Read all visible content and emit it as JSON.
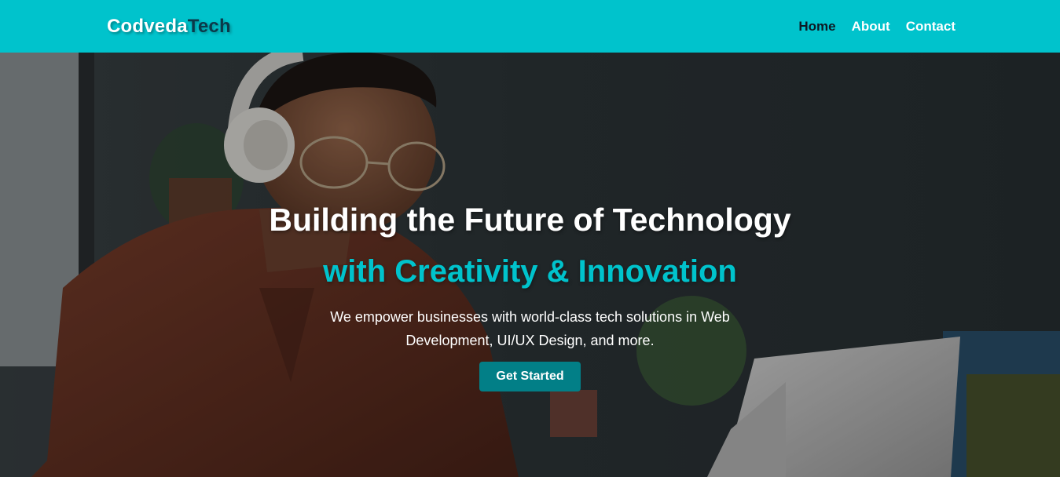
{
  "navbar": {
    "logo_primary": "Codveda",
    "logo_secondary": "Tech",
    "links": [
      {
        "label": "Home",
        "active": true
      },
      {
        "label": "About",
        "active": false
      },
      {
        "label": "Contact",
        "active": false
      }
    ]
  },
  "hero": {
    "title": "Building the Future of Technology",
    "subtitle": "with Creativity & Innovation",
    "description": "We empower businesses with world-class tech solutions in Web Development, UI/UX Design, and more.",
    "cta_label": "Get Started"
  },
  "colors": {
    "accent": "#00c3cc",
    "cta": "#027f87",
    "nav_active": "#0d1a24"
  }
}
